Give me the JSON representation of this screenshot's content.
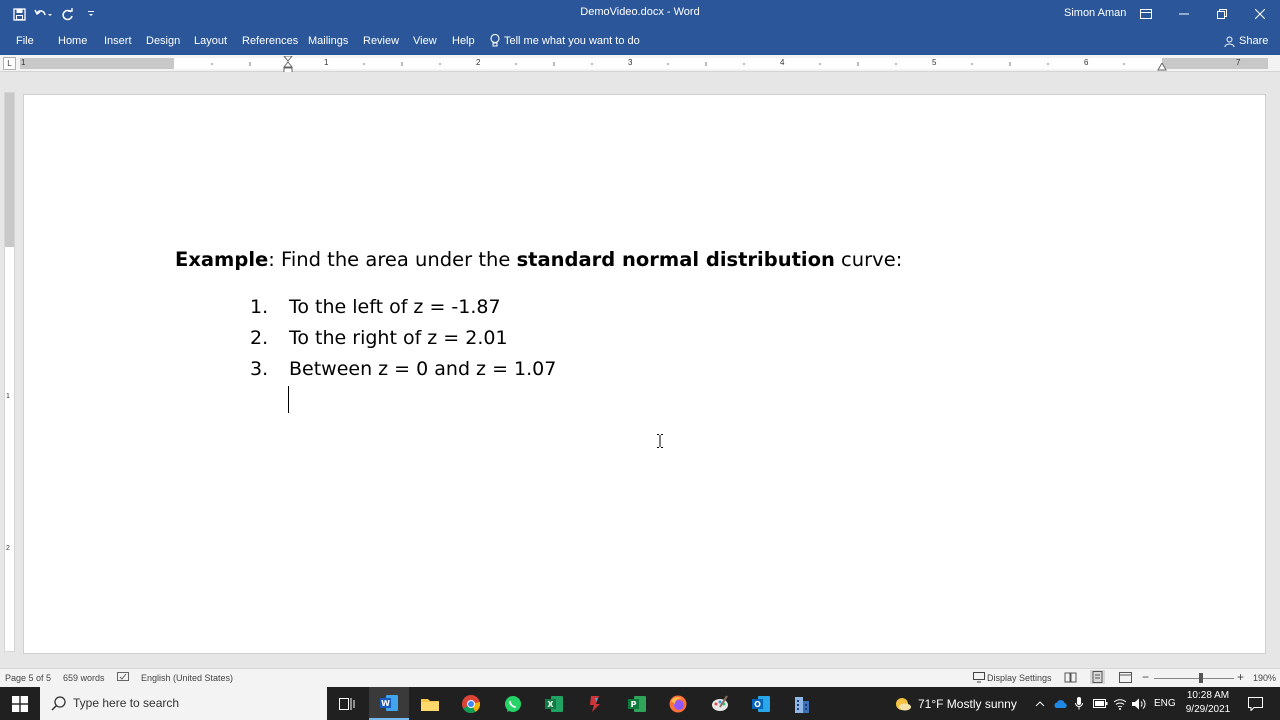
{
  "window": {
    "title": "DemoVideo.docx  -  Word",
    "user": "Simon Aman"
  },
  "ribbon": {
    "tabs": [
      "File",
      "Home",
      "Insert",
      "Design",
      "Layout",
      "References",
      "Mailings",
      "Review",
      "View",
      "Help"
    ],
    "tell_me": "Tell me what you want to do",
    "share": "Share"
  },
  "ruler": {
    "numbers": [
      "1",
      "1",
      "2",
      "3",
      "4",
      "5",
      "6",
      "7"
    ],
    "vertical_numbers": [
      "1",
      "2"
    ],
    "tab_selector": "L"
  },
  "document": {
    "heading": {
      "bold1": "Example",
      "text1": ": Find the area under the ",
      "bold2": "standard normal distribution",
      "text2": " curve:"
    },
    "list": [
      {
        "num": "1.",
        "text": "To the left of z = -1.87"
      },
      {
        "num": "2.",
        "text": "To the right of z = 2.01"
      },
      {
        "num": "3.",
        "text": "Between z = 0 and z = 1.07"
      }
    ]
  },
  "status": {
    "page": "Page 5 of 5",
    "words": "659 words",
    "language": "English (United States)",
    "display_settings": "Display Settings",
    "zoom": "190%",
    "zoom_fraction": 0.59
  },
  "taskbar": {
    "search_placeholder": "Type here to search",
    "weather": "71°F  Mostly sunny",
    "lang": "ENG",
    "time": "10:28 AM",
    "date": "9/29/2021"
  },
  "colors": {
    "word_blue": "#2b579a",
    "taskbar": "#202020"
  }
}
